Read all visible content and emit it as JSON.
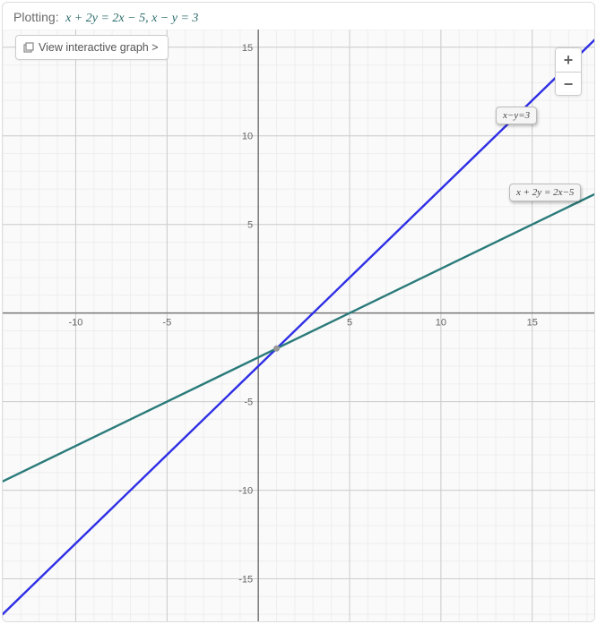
{
  "header": {
    "label": "Plotting:",
    "expression": "x + 2y = 2x − 5, x − y = 3"
  },
  "interactive_button": "View interactive graph >",
  "zoom": {
    "in": "+",
    "out": "−"
  },
  "line_labels": {
    "line1": "x−y=3",
    "line2": "x + 2y = 2x−5"
  },
  "axis": {
    "x_ticks": [
      "-10",
      "-5",
      "5",
      "10",
      "15"
    ],
    "y_ticks_pos": [
      "5",
      "10",
      "15"
    ],
    "y_ticks_neg": [
      "-5",
      "-10",
      "-15"
    ]
  },
  "chart_data": {
    "type": "line",
    "title": "",
    "xlabel": "",
    "ylabel": "",
    "xlim": [
      -14,
      18.5
    ],
    "ylim": [
      -17.5,
      16
    ],
    "grid": true,
    "series": [
      {
        "name": "x−y=3",
        "equation": "y = x - 3",
        "slope": 1,
        "intercept": -3,
        "color": "#2e2ee6",
        "points_sample": [
          [
            -14,
            -17
          ],
          [
            0,
            -3
          ],
          [
            3,
            0
          ],
          [
            18.5,
            15.5
          ]
        ]
      },
      {
        "name": "x + 2y = 2x − 5",
        "equation": "y = (x - 5) / 2",
        "slope": 0.5,
        "intercept": -2.5,
        "color": "#2a7a7a",
        "points_sample": [
          [
            -14,
            -9.5
          ],
          [
            0,
            -2.5
          ],
          [
            5,
            0
          ],
          [
            18.5,
            6.75
          ]
        ]
      }
    ],
    "intersection": {
      "x": 1,
      "y": -2
    },
    "annotations": [
      {
        "text": "x−y=3",
        "near": [
          14,
          11
        ]
      },
      {
        "text": "x + 2y = 2x−5",
        "near": [
          16,
          5.5
        ]
      }
    ]
  }
}
